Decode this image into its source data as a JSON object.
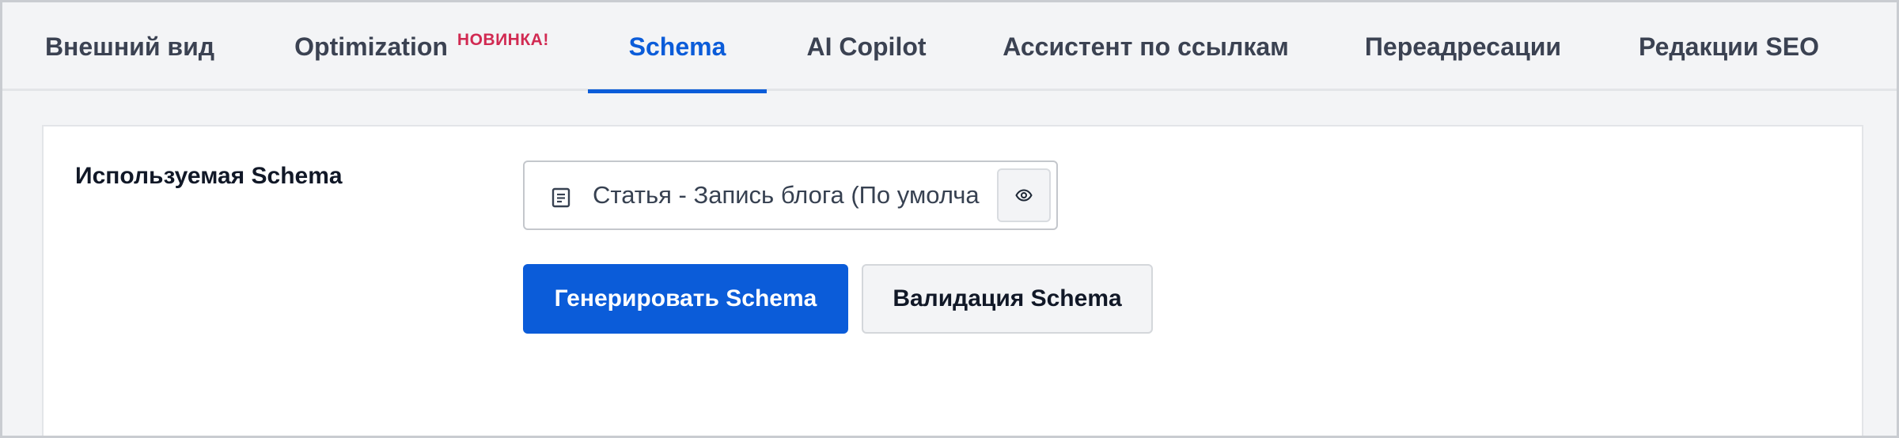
{
  "tabs": [
    {
      "label": "Внешний вид"
    },
    {
      "label": "Optimization",
      "badge": "НОВИНКА!"
    },
    {
      "label": "Schema",
      "active": true
    },
    {
      "label": "AI Copilot"
    },
    {
      "label": "Ассистент по ссылкам"
    },
    {
      "label": "Переадресации"
    },
    {
      "label": "Редакции SEO"
    }
  ],
  "schema_row": {
    "label": "Используемая Schema",
    "select_value": "Статья - Запись блога (По умолчанию)",
    "preview_icon": "eye-icon",
    "select_icon": "document-icon"
  },
  "actions": {
    "generate_label": "Генерировать Schema",
    "validate_label": "Валидация Schema"
  },
  "colors": {
    "accent": "#0b5cd9",
    "badge": "#d12a52",
    "tab_text": "#3b4252",
    "background": "#f3f4f6"
  }
}
